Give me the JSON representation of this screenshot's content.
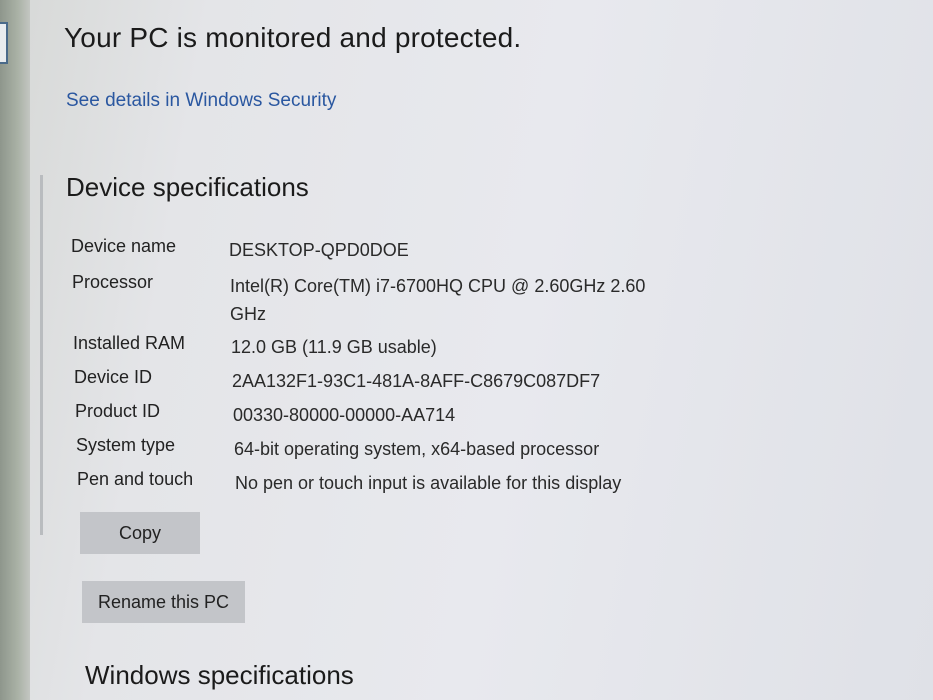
{
  "protection": {
    "status_text": "Your PC is monitored and protected.",
    "details_link": "See details in Windows Security"
  },
  "device_specifications": {
    "title": "Device specifications",
    "rows": [
      {
        "label": "Device name",
        "value": "DESKTOP-QPD0DOE"
      },
      {
        "label": "Processor",
        "value": "Intel(R) Core(TM) i7-6700HQ CPU @ 2.60GHz   2.60 GHz"
      },
      {
        "label": "Installed RAM",
        "value": "12.0 GB (11.9 GB usable)"
      },
      {
        "label": "Device ID",
        "value": "2AA132F1-93C1-481A-8AFF-C8679C087DF7"
      },
      {
        "label": "Product ID",
        "value": "00330-80000-00000-AA714"
      },
      {
        "label": "System type",
        "value": "64-bit operating system, x64-based processor"
      },
      {
        "label": "Pen and touch",
        "value": "No pen or touch input is available for this display"
      }
    ],
    "copy_label": "Copy",
    "rename_label": "Rename this PC"
  },
  "windows_specifications": {
    "title": "Windows specifications"
  },
  "colors": {
    "link": "#2a57a0",
    "button_bg": "#c3c5c9"
  }
}
